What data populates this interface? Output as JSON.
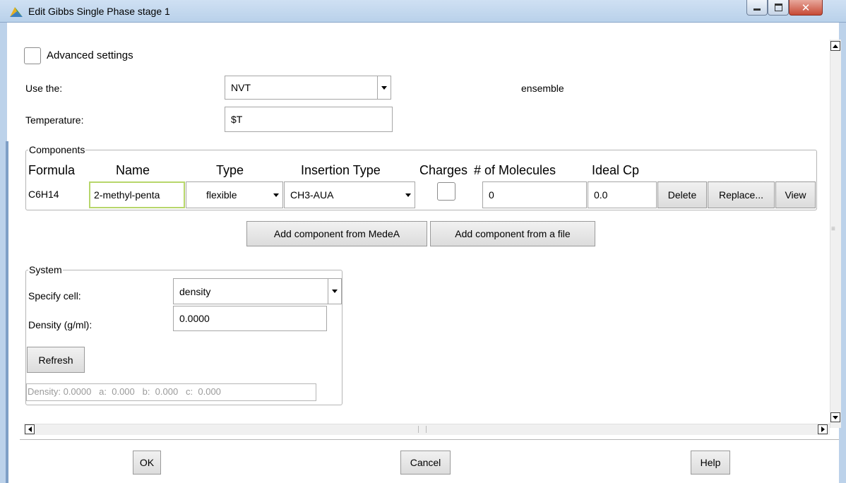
{
  "window": {
    "title": "Edit Gibbs Single Phase stage 1"
  },
  "advanced": {
    "label": "Advanced settings"
  },
  "ensemble": {
    "use_label": "Use the:",
    "value": "NVT",
    "suffix": "ensemble"
  },
  "temperature": {
    "label": "Temperature:",
    "value": "$T"
  },
  "components": {
    "legend": "Components",
    "headers": {
      "formula": "Formula",
      "name": "Name",
      "type": "Type",
      "insertion": "Insertion Type",
      "charges": "Charges",
      "molecules": "# of Molecules",
      "cp": "Ideal Cp"
    },
    "row": {
      "formula": "C6H14",
      "name": "2-methyl-penta",
      "type": "flexible",
      "insertion": "CH3-AUA",
      "molecules": "0",
      "cp": "0.0"
    },
    "delete_label": "Delete",
    "replace_label": "Replace...",
    "view_label": "View",
    "add_medea_label": "Add component from MedeA",
    "add_file_label": "Add component from a file"
  },
  "system": {
    "legend": "System",
    "specify_label": "Specify cell:",
    "specify_value": "density",
    "density_label": "Density (g/ml):",
    "density_value": "0.0000",
    "refresh_label": "Refresh",
    "summary": "Density: 0.0000   a:  0.000   b:  0.000   c:  0.000"
  },
  "footer": {
    "ok": "OK",
    "cancel": "Cancel",
    "help": "Help"
  },
  "icons": [
    "app-icon",
    "minimize-icon",
    "maximize-icon",
    "close-icon",
    "dropdown-arrow-icon",
    "scroll-up-icon",
    "scroll-down-icon",
    "scroll-left-icon",
    "scroll-right-icon"
  ]
}
